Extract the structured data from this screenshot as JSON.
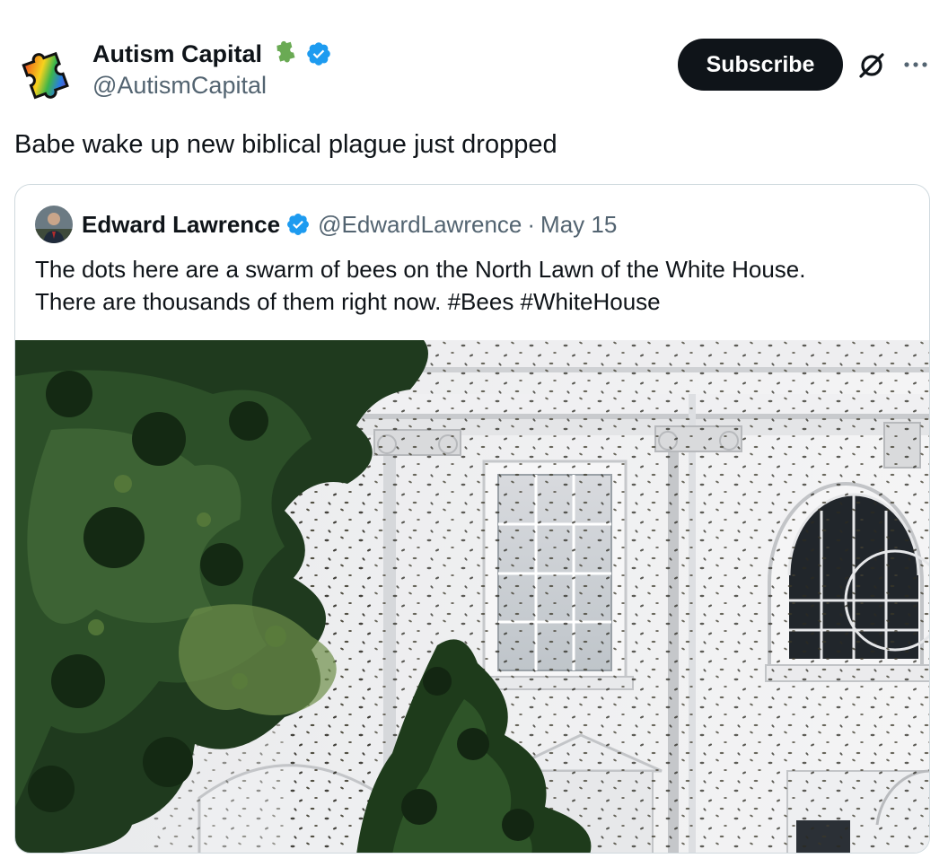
{
  "tweet": {
    "author_name": "Autism Capital",
    "author_handle": "@AutismCapital",
    "subscribe_label": "Subscribe",
    "text": "Babe wake up new biblical plague just dropped"
  },
  "quote": {
    "author_name": "Edward Lawrence",
    "author_handle": "@EdwardLawrence",
    "separator": "·",
    "date": "May 15",
    "text_line1": "The dots here are a swarm of bees on the North Lawn of the White House.",
    "text_line2": "There are thousands of them right now. #Bees #WhiteHouse"
  },
  "icons": {
    "avatar": "rainbow-puzzle-piece",
    "badge": "green-puzzle-piece-icon",
    "verified": "blue-verified-check-icon",
    "grok": "grok-icon",
    "more": "more-horizontal-icon"
  },
  "colors": {
    "text_primary": "#0f1419",
    "text_secondary": "#536471",
    "verified_blue": "#1d9bf0",
    "button_bg": "#0f1419",
    "border": "#cfd9de",
    "clover_green": "#6aaa54"
  }
}
